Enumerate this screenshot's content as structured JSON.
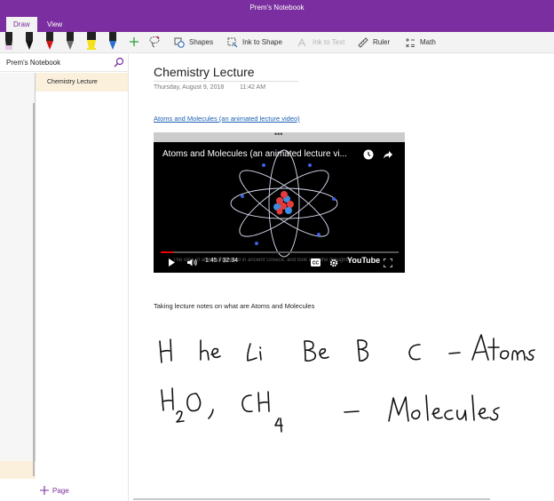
{
  "window": {
    "title": "Prem's Notebook"
  },
  "tabs": [
    {
      "label": "Draw"
    },
    {
      "label": "View"
    }
  ],
  "ribbon": {
    "pens": [
      {
        "name": "eraser",
        "color": "#e9c6e6"
      },
      {
        "name": "pen-black",
        "color": "#111111"
      },
      {
        "name": "pen-red",
        "color": "#d01515"
      },
      {
        "name": "pen-gray",
        "color": "#6b6b6b"
      },
      {
        "name": "highlighter-yellow",
        "color": "#f5e21b"
      },
      {
        "name": "pen-blue",
        "color": "#2a6fcf"
      }
    ],
    "shapes_label": "Shapes",
    "ink_to_shape_label": "Ink to Shape",
    "ink_to_text_label": "Ink to Text",
    "ruler_label": "Ruler",
    "math_label": "Math"
  },
  "sidebar": {
    "notebook_name": "Prem's Notebook",
    "pages": [
      {
        "label": "Chemistry Lecture"
      }
    ],
    "add_page_label": "Page"
  },
  "page": {
    "title": "Chemistry Lecture",
    "date": "Thursday, August 9, 2018",
    "time": "11:42 AM",
    "link_text": "Atoms and Molecules (an animated lecture video)",
    "video": {
      "title": "Atoms and Molecules (an animated lecture vi...",
      "time": "1:45 / 32:34",
      "progress": 0.054,
      "caption": "The idea of atoms originated in ancient Greece, and took over the thoughts...",
      "logo": "YouTube"
    },
    "notes_text": "Taking lecture notes on what are Atoms and Molecules"
  }
}
